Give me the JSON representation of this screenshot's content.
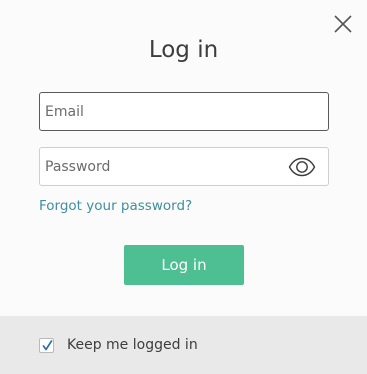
{
  "dialog": {
    "title": "Log in",
    "close_icon": "close-icon"
  },
  "form": {
    "email_placeholder": "Email",
    "email_value": "",
    "password_placeholder": "Password",
    "password_value": "",
    "password_toggle_icon": "eye-icon",
    "forgot_password": "Forgot your password?",
    "submit_label": "Log in"
  },
  "footer": {
    "keep_logged_in_label": "Keep me logged in",
    "keep_logged_in_checked": true,
    "check_icon": "checkmark-icon"
  },
  "colors": {
    "accent": "#4dbf92",
    "link": "#3f8f9e",
    "footer_bg": "#e9e9e9"
  }
}
